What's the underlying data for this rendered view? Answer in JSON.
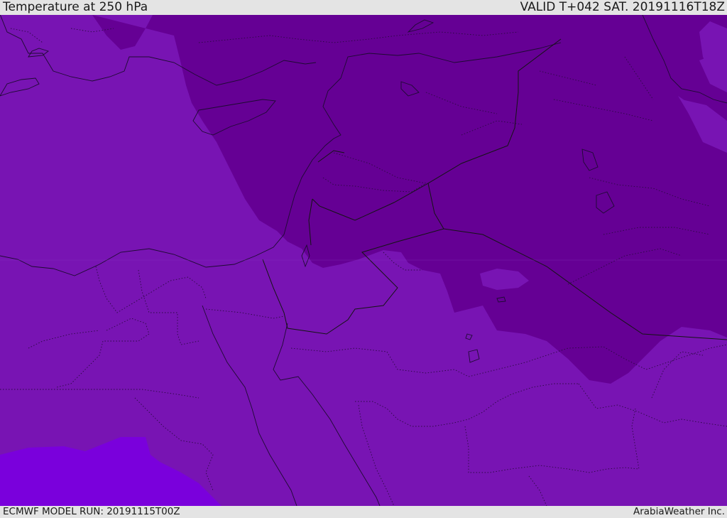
{
  "header": {
    "title": "Temperature at 250 hPa",
    "valid": "VALID T+042 SAT. 20191116T18Z"
  },
  "footer": {
    "model_run": "ECMWF MODEL RUN: 20191115T00Z",
    "credit": "ArabiaWeather Inc."
  },
  "map": {
    "colors": {
      "base": "#7814b3",
      "cold": "#650094",
      "warm": "#7a00dc",
      "coast": "#1e0a32",
      "border": "#141414"
    }
  }
}
